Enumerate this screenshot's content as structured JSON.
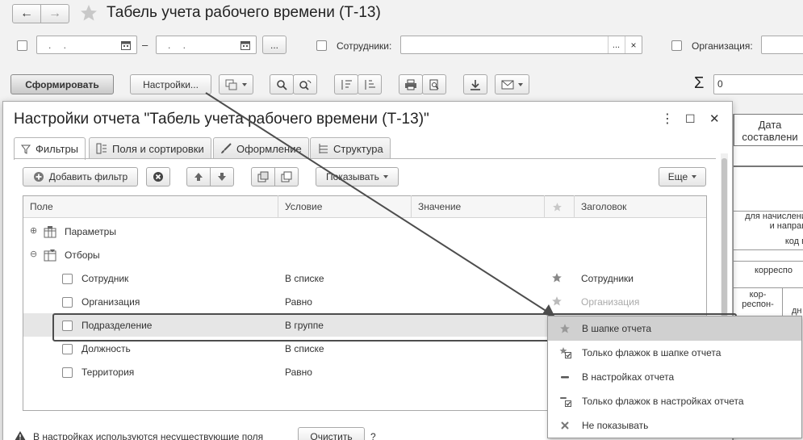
{
  "window": {
    "title": "Табель учета рабочего времени (Т-13)",
    "nav_back": "←",
    "nav_forward": "→"
  },
  "filters_bar": {
    "date_from_placeholder": ". .",
    "date_to_placeholder": ". .",
    "dash": "–",
    "ellipsis": "...",
    "employees_label": "Сотрудники:",
    "employees_select": "...",
    "employees_clear": "×",
    "organization_label": "Организация:"
  },
  "toolbar": {
    "generate_button": "Сформировать",
    "settings_button": "Настройки...",
    "sum_label": "Σ",
    "sum_value": "0"
  },
  "report_preview": {
    "header_date_line1": "Дата",
    "header_date_line2": "составлени",
    "cell_1_line1": "для начислени",
    "cell_1_line2": "и направ",
    "cell_2": "код в",
    "cell_3": "корреспо",
    "cell_4_line1": "кор-",
    "cell_4_line2": "респон-",
    "cell_5": "дн"
  },
  "dialog": {
    "title": "Настройки отчета \"Табель учета рабочего времени (Т-13)\"",
    "more_icon": "⋮",
    "maximize_icon": "☐",
    "close_icon": "✕",
    "tabs": [
      {
        "label": "Фильтры"
      },
      {
        "label": "Поля и сортировки"
      },
      {
        "label": "Оформление"
      },
      {
        "label": "Структура"
      }
    ],
    "add_filter_button": "Добавить фильтр",
    "show_button": "Показывать",
    "more_button": "Еще",
    "columns": {
      "field": "Поле",
      "condition": "Условие",
      "value": "Значение",
      "header": "Заголовок"
    },
    "groups": [
      {
        "label": "Параметры",
        "expander": "⊕"
      },
      {
        "label": "Отборы",
        "expander": "⊖"
      }
    ],
    "rows": [
      {
        "field": "Сотрудник",
        "condition": "В списке",
        "header": "Сотрудники"
      },
      {
        "field": "Организация",
        "condition": "Равно",
        "header": "Организация"
      },
      {
        "field": "Подразделение",
        "condition": "В группе",
        "header": ""
      },
      {
        "field": "Должность",
        "condition": "В списке",
        "header": ""
      },
      {
        "field": "Территория",
        "condition": "Равно",
        "header": ""
      }
    ],
    "warning_text": "В настройках используются несуществующие поля",
    "clear_button": "Очистить",
    "help_mark": "?"
  },
  "display_menu": {
    "items": [
      {
        "label": "В шапке отчета",
        "icon": "star-icon"
      },
      {
        "label": "Только флажок в шапке отчета",
        "icon": "star-checkbox-icon"
      },
      {
        "label": "В настройках отчета",
        "icon": "dash-icon"
      },
      {
        "label": "Только флажок в настройках отчета",
        "icon": "dash-checkbox-icon"
      },
      {
        "label": "Не показывать",
        "icon": "cross-icon"
      }
    ]
  },
  "colors": {
    "accent": "#4d4d4d",
    "highlight_row": "#e6e6e6",
    "menu_selected": "#d0d0d0"
  }
}
